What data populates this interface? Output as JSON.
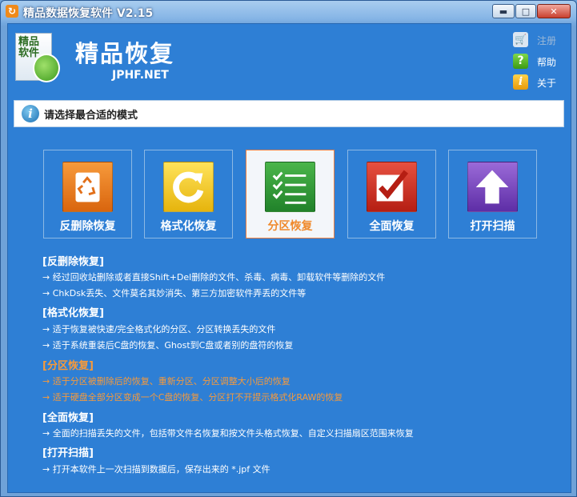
{
  "window": {
    "title": "精品数据恢复软件 V2.15",
    "controls": {
      "minimize": "▬",
      "maximize": "□",
      "close": "✕"
    }
  },
  "header": {
    "logo_text": "精品软件",
    "app_name": "精品恢复",
    "app_sub": "JPHF.NET",
    "links": [
      {
        "label": "注册",
        "icon": "cart-icon",
        "enabled": false
      },
      {
        "label": "帮助",
        "icon": "help-icon",
        "enabled": true
      },
      {
        "label": "关于",
        "icon": "info-icon",
        "enabled": true
      }
    ]
  },
  "mode_prompt": "请选择最合适的模式",
  "modes": [
    {
      "label": "反删除恢复",
      "icon": "recycle-icon",
      "selected": false
    },
    {
      "label": "格式化恢复",
      "icon": "refresh-icon",
      "selected": false
    },
    {
      "label": "分区恢复",
      "icon": "checklist-icon",
      "selected": true
    },
    {
      "label": "全面恢复",
      "icon": "checkbox-icon",
      "selected": false
    },
    {
      "label": "打开扫描",
      "icon": "up-arrow-icon",
      "selected": false
    }
  ],
  "descriptions": [
    {
      "heading": "[反删除恢复]",
      "lines": [
        "→ 经过回收站删除或者直接Shift+Del删除的文件、杀毒、病毒、卸载软件等删除的文件",
        "→ ChkDsk丢失、文件莫名其妙消失、第三方加密软件弄丢的文件等"
      ],
      "highlight": false
    },
    {
      "heading": "[格式化恢复]",
      "lines": [
        "→ 适于恢复被快速/完全格式化的分区、分区转换丢失的文件",
        "→ 适于系统重装后C盘的恢复、Ghost到C盘或者别的盘符的恢复"
      ],
      "highlight": false
    },
    {
      "heading": "[分区恢复]",
      "lines": [
        "→ 适于分区被删除后的恢复、重新分区、分区调整大小后的恢复",
        "→ 适于硬盘全部分区变成一个C盘的恢复、分区打不开提示格式化RAW的恢复"
      ],
      "highlight": true
    },
    {
      "heading": "[全面恢复]",
      "lines": [
        "→ 全面的扫描丢失的文件，包括带文件名恢复和按文件头格式恢复、自定义扫描扇区范围来恢复"
      ],
      "highlight": false
    },
    {
      "heading": "[打开扫描]",
      "lines": [
        "→ 打开本软件上一次扫描到数据后，保存出来的 *.jpf 文件"
      ],
      "highlight": false
    }
  ],
  "colors": {
    "accent": "#f08a2c",
    "panel": "#2e7fd5"
  }
}
